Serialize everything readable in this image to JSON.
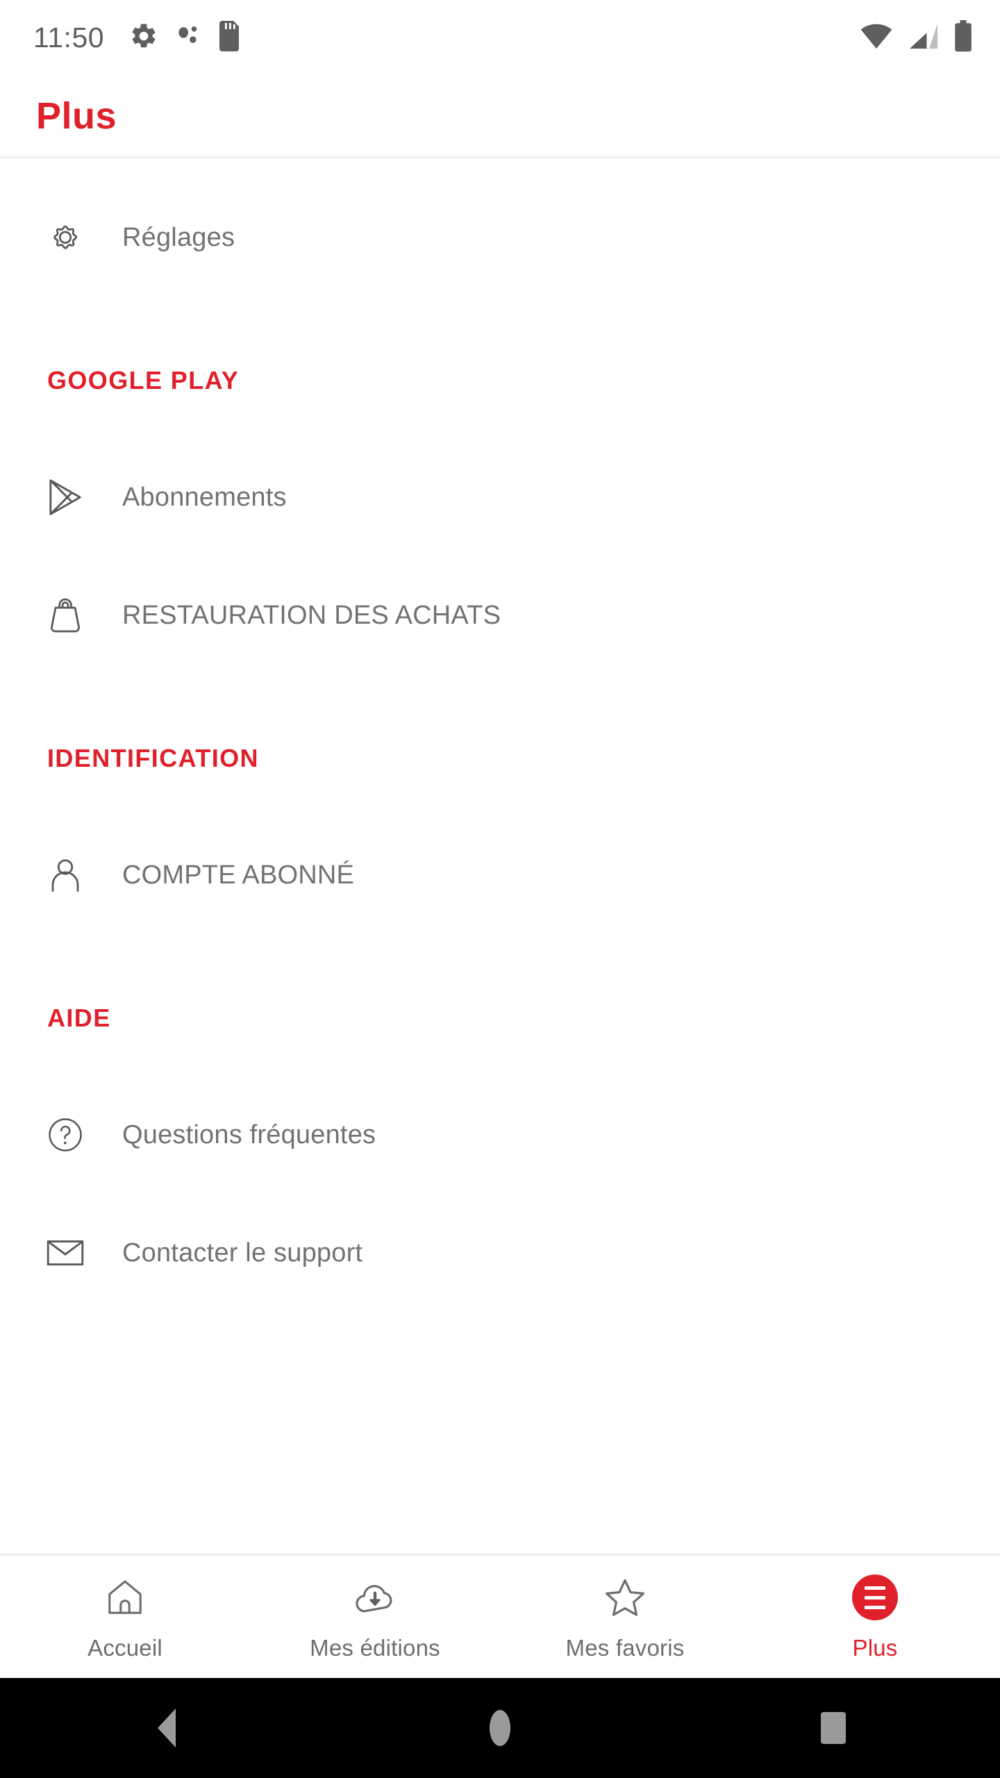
{
  "status_bar": {
    "time": "11:50",
    "left_icons": [
      "gear-icon",
      "dots-icon",
      "sd-card-icon"
    ],
    "right_icons": [
      "wifi-icon",
      "signal-icon",
      "battery-icon"
    ]
  },
  "app_bar": {
    "title": "Plus",
    "title_color": "#e0202a"
  },
  "sections": [
    {
      "header": null,
      "items": [
        {
          "icon": "gear-icon",
          "label": "Réglages"
        }
      ]
    },
    {
      "header": "GOOGLE PLAY",
      "items": [
        {
          "icon": "google-play-icon",
          "label": "Abonnements"
        },
        {
          "icon": "shopping-bag-icon",
          "label": "RESTAURATION DES ACHATS"
        }
      ]
    },
    {
      "header": "IDENTIFICATION",
      "items": [
        {
          "icon": "person-icon",
          "label": "COMPTE ABONNÉ"
        }
      ]
    },
    {
      "header": "AIDE",
      "items": [
        {
          "icon": "question-circle-icon",
          "label": "Questions fréquentes"
        },
        {
          "icon": "envelope-icon",
          "label": "Contacter le support"
        }
      ]
    }
  ],
  "flat": {
    "reglages": "Réglages",
    "google_play_header": "GOOGLE PLAY",
    "abonnements": "Abonnements",
    "restauration": "RESTAURATION DES ACHATS",
    "identification_header": "IDENTIFICATION",
    "compte_abonne": "COMPTE ABONNÉ",
    "aide_header": "AIDE",
    "questions": "Questions fréquentes",
    "contacter": "Contacter le support"
  },
  "tab_bar": {
    "active": "Plus",
    "tabs": [
      {
        "icon": "home-icon",
        "label": "Accueil",
        "active": false
      },
      {
        "icon": "cloud-download-icon",
        "label": "Mes éditions",
        "active": false
      },
      {
        "icon": "star-icon",
        "label": "Mes favoris",
        "active": false
      },
      {
        "icon": "hamburger-icon",
        "label": "Plus",
        "active": true
      }
    ]
  },
  "system_nav": {
    "back": "back-button",
    "home": "home-button",
    "recents": "recents-button"
  },
  "colors": {
    "accent_red": "#e0202a",
    "text_gray": "#727272",
    "divider": "#eeeeee"
  }
}
